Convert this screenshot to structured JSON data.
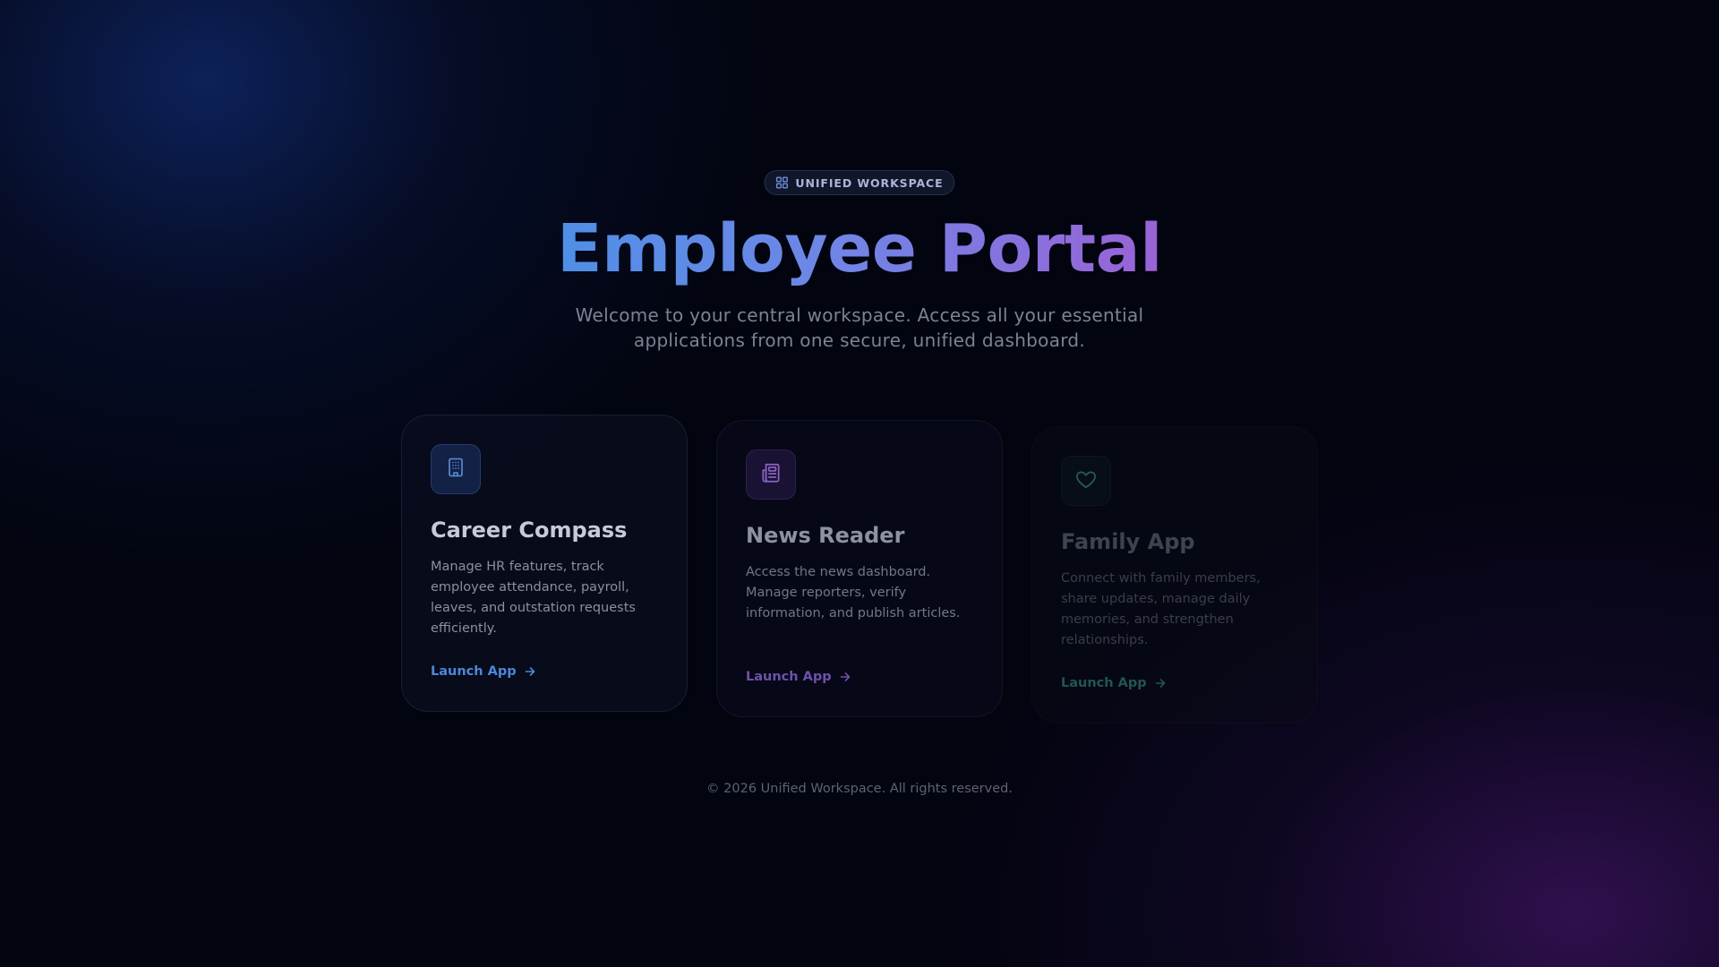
{
  "badge": {
    "icon": "grid-icon",
    "label": "UNIFIED WORKSPACE"
  },
  "hero": {
    "title": "Employee Portal",
    "subtitle": "Welcome to your central workspace. Access all your essential applications from one secure, unified dashboard."
  },
  "apps": [
    {
      "icon": "building-icon",
      "title": "Career Compass",
      "description": "Manage HR features, track employee attendance, payroll, leaves, and outstation requests efficiently.",
      "launch_label": "Launch App",
      "accent": "#4e86d8"
    },
    {
      "icon": "newspaper-icon",
      "title": "News Reader",
      "description": "Access the news dashboard. Manage reporters, verify information, and publish articles.",
      "launch_label": "Launch App",
      "accent": "#7050aa"
    },
    {
      "icon": "heart-icon",
      "title": "Family App",
      "description": "Connect with family members, share updates, manage daily memories, and strengthen relationships.",
      "launch_label": "Launch App",
      "accent": "#225553"
    }
  ],
  "footer": {
    "text": "© 2026 Unified Workspace. All rights reserved."
  },
  "colors": {
    "background": "#02040f",
    "title_gradient_start": "#4f8fe6",
    "title_gradient_end": "#9a62d6"
  }
}
